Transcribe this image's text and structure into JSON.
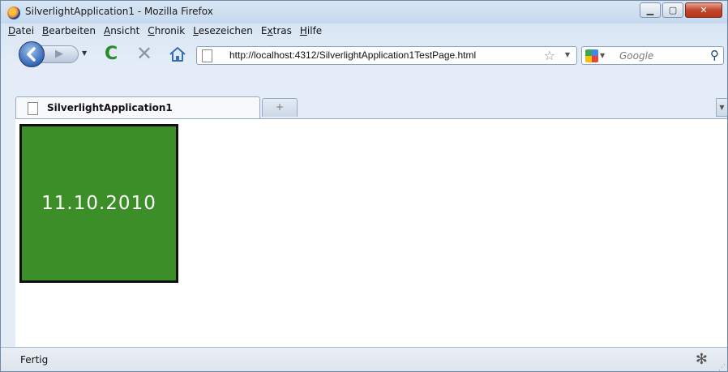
{
  "window": {
    "title": "SilverlightApplication1 - Mozilla Firefox"
  },
  "menubar": {
    "items": [
      {
        "accel": "D",
        "rest": "atei"
      },
      {
        "accel": "B",
        "rest": "earbeiten"
      },
      {
        "accel": "A",
        "rest": "nsicht"
      },
      {
        "accel": "C",
        "rest": "hronik"
      },
      {
        "accel": "L",
        "rest": "esezeichen"
      },
      {
        "pre": "E",
        "accel": "x",
        "rest": "tras"
      },
      {
        "accel": "H",
        "rest": "ilfe"
      }
    ]
  },
  "navbar": {
    "url": "http://localhost:4312/SilverlightApplication1TestPage.html",
    "search_placeholder": "Google"
  },
  "tabs": [
    {
      "label": "SilverlightApplication1"
    }
  ],
  "content": {
    "date": "11.10.2010",
    "box_color": "#3c8f28"
  },
  "status": {
    "text": "Fertig"
  }
}
